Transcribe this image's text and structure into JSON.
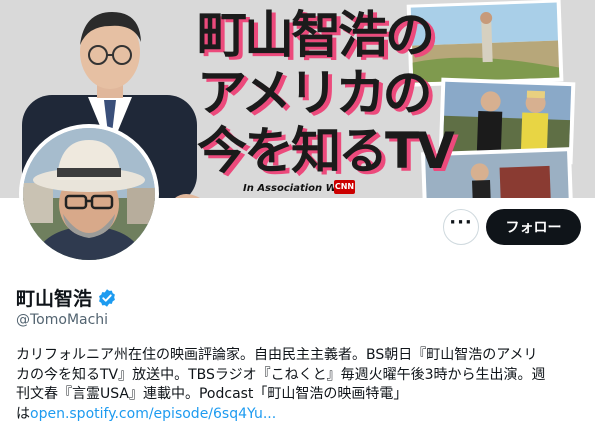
{
  "banner": {
    "title_lines": [
      "町山智浩の",
      "アメリカの",
      "今を知るTV"
    ],
    "association_text": "In Association With",
    "partner_logo": "CNN"
  },
  "profile": {
    "display_name": "町山智浩",
    "handle": "@TomoMachi",
    "verified_icon": "verified-badge-icon",
    "accent_color": "#1d9bf0"
  },
  "actions": {
    "more_icon": "more-horizontal-icon",
    "more_label": "···",
    "follow_label": "フォロー"
  },
  "bio": {
    "lines": [
      "カリフォルニア州在住の映画評論家。自由民主主義者。BS朝日『町山智浩のアメリ",
      "カの今を知るTV』放送中。TBSラジオ『こねくと』毎週火曜午後3時から生出演。週",
      "刊文春『言霊USA』連載中。Podcast「町山智浩の映画特電」"
    ],
    "link_prefix": "は",
    "link_text": "open.spotify.com/episode/6sq4Yu..."
  }
}
